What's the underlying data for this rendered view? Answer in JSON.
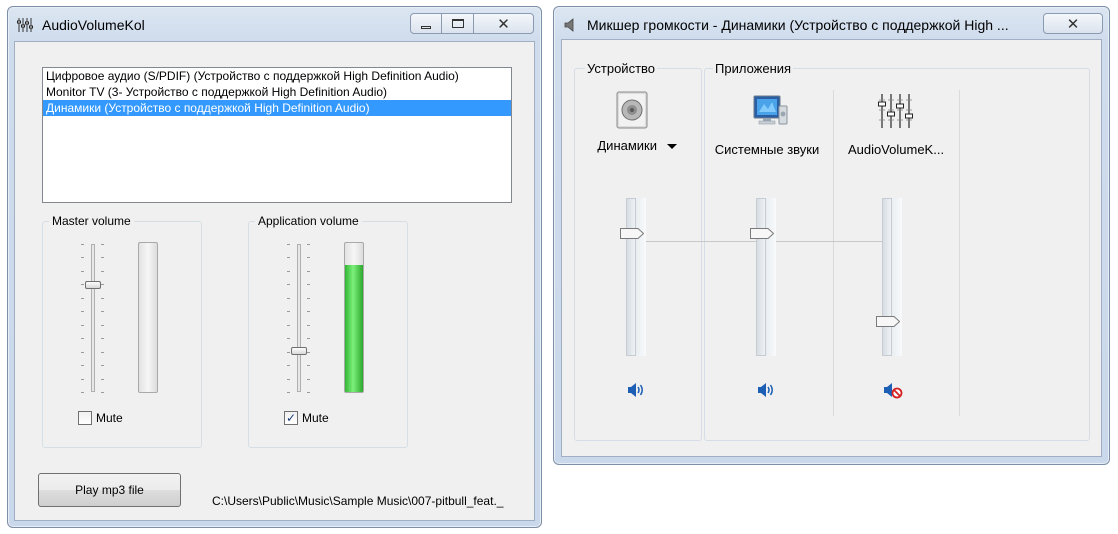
{
  "left_window": {
    "title": "AudioVolumeKol",
    "devices": [
      "Цифровое аудио (S/PDIF) (Устройство с поддержкой High Definition Audio)",
      "Monitor TV (3- Устройство с поддержкой High Definition Audio)",
      "Динамики (Устройство с поддержкой High Definition Audio)"
    ],
    "selected_device_index": 2,
    "master": {
      "label": "Master volume",
      "slider_level": 0.72,
      "meter_level": 0.0,
      "mute_label": "Mute",
      "muted": false
    },
    "application": {
      "label": "Application volume",
      "slider_level": 0.28,
      "meter_level": 0.85,
      "mute_label": "Mute",
      "muted": true
    },
    "play_button": "Play mp3 file",
    "file_path": "C:\\Users\\Public\\Music\\Sample Music\\007-pitbull_feat._"
  },
  "right_window": {
    "title": "Микшер громкости - Динамики (Устройство с поддержкой High ...",
    "device_section_label": "Устройство",
    "apps_section_label": "Приложения",
    "channels": [
      {
        "name": "Динамики",
        "has_dropdown": true,
        "level": 0.78,
        "muted": false,
        "icon": "speaker-device-icon"
      },
      {
        "name": "Системные звуки",
        "has_dropdown": false,
        "level": 0.78,
        "muted": false,
        "icon": "system-sounds-icon"
      },
      {
        "name": "AudioVolumeK...",
        "has_dropdown": false,
        "level": 0.22,
        "muted": true,
        "icon": "mixer-app-icon"
      }
    ],
    "colors": {
      "selection": "#3399ff",
      "meter_green": "#33b533",
      "speaker_blue": "#1c5fb5",
      "mute_red": "#d42020"
    }
  }
}
